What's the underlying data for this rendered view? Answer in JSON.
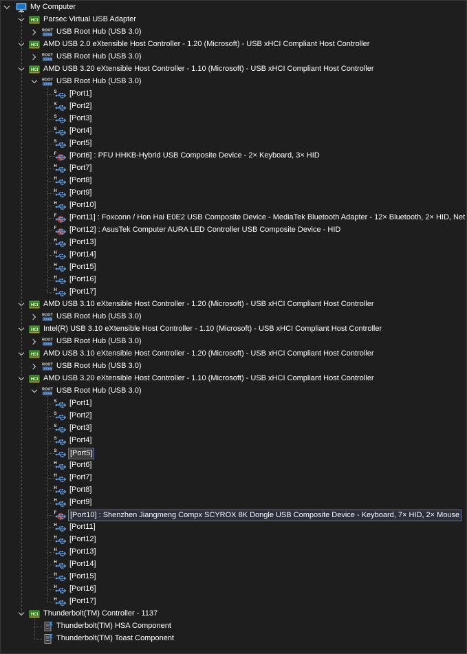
{
  "tree": {
    "root": {
      "label": "My Computer",
      "icon": "computer-icon"
    },
    "controllers": [
      {
        "label": "Parsec Virtual USB Adapter",
        "hub": {
          "label": "USB Root Hub (USB 3.0)",
          "expanded": false,
          "ports": []
        }
      },
      {
        "label": "AMD USB 2.0 eXtensible Host Controller - 1.20 (Microsoft) - USB xHCI Compliant Host Controller",
        "hub": {
          "label": "USB Root Hub (USB 3.0)",
          "expanded": false,
          "ports": []
        }
      },
      {
        "label": "AMD USB 3.20 eXtensible Host Controller - 1.10 (Microsoft) - USB xHCI Compliant Host Controller",
        "hub": {
          "label": "USB Root Hub (USB 3.0)",
          "expanded": true,
          "ports": [
            {
              "label": "[Port1]",
              "type": "S"
            },
            {
              "label": "[Port2]",
              "type": "S"
            },
            {
              "label": "[Port3]",
              "type": "S"
            },
            {
              "label": "[Port4]",
              "type": "S"
            },
            {
              "label": "[Port5]",
              "type": "S"
            },
            {
              "label": "[Port6] : PFU HHKB-Hybrid USB Composite Device - 2× Keyboard, 3× HID",
              "type": "F"
            },
            {
              "label": "[Port7]",
              "type": "H"
            },
            {
              "label": "[Port8]",
              "type": "H"
            },
            {
              "label": "[Port9]",
              "type": "H"
            },
            {
              "label": "[Port10]",
              "type": "H"
            },
            {
              "label": "[Port11] : Foxconn / Hon Hai E0E2 USB Composite Device - MediaTek Bluetooth Adapter - 12× Bluetooth, 2× HID, Net",
              "type": "F"
            },
            {
              "label": "[Port12] : AsusTek Computer AURA LED Controller USB Composite Device - HID",
              "type": "F"
            },
            {
              "label": "[Port13]",
              "type": "H"
            },
            {
              "label": "[Port14]",
              "type": "H"
            },
            {
              "label": "[Port15]",
              "type": "H"
            },
            {
              "label": "[Port16]",
              "type": "H"
            },
            {
              "label": "[Port17]",
              "type": "H"
            }
          ]
        }
      },
      {
        "label": "AMD USB 3.10 eXtensible Host Controller - 1.20 (Microsoft) - USB xHCI Compliant Host Controller",
        "hub": {
          "label": "USB Root Hub (USB 3.0)",
          "expanded": false,
          "ports": []
        }
      },
      {
        "label": "Intel(R) USB 3.10 eXtensible Host Controller - 1.10 (Microsoft) - USB xHCI Compliant Host Controller",
        "hub": {
          "label": "USB Root Hub (USB 3.0)",
          "expanded": false,
          "ports": []
        }
      },
      {
        "label": "AMD USB 3.10 eXtensible Host Controller - 1.20 (Microsoft) - USB xHCI Compliant Host Controller",
        "hub": {
          "label": "USB Root Hub (USB 3.0)",
          "expanded": false,
          "ports": []
        }
      },
      {
        "label": "AMD USB 3.20 eXtensible Host Controller - 1.10 (Microsoft) - USB xHCI Compliant Host Controller",
        "hub": {
          "label": "USB Root Hub (USB 3.0)",
          "expanded": true,
          "ports": [
            {
              "label": "[Port1]",
              "type": "S"
            },
            {
              "label": "[Port2]",
              "type": "S"
            },
            {
              "label": "[Port3]",
              "type": "S"
            },
            {
              "label": "[Port4]",
              "type": "S"
            },
            {
              "label": "[Port5]",
              "type": "S",
              "state": "highlighted"
            },
            {
              "label": "[Port6]",
              "type": "H"
            },
            {
              "label": "[Port7]",
              "type": "H"
            },
            {
              "label": "[Port8]",
              "type": "H"
            },
            {
              "label": "[Port9]",
              "type": "H"
            },
            {
              "label": "[Port10] : Shenzhen Jiangmeng Compx SCYROX 8K Dongle USB Composite Device - Keyboard, 7× HID, 2× Mouse",
              "type": "F",
              "state": "selected"
            },
            {
              "label": "[Port11]",
              "type": "H"
            },
            {
              "label": "[Port12]",
              "type": "H"
            },
            {
              "label": "[Port13]",
              "type": "H"
            },
            {
              "label": "[Port14]",
              "type": "H"
            },
            {
              "label": "[Port15]",
              "type": "H"
            },
            {
              "label": "[Port16]",
              "type": "H"
            },
            {
              "label": "[Port17]",
              "type": "H"
            }
          ]
        }
      }
    ],
    "thunderbolt": {
      "label": "Thunderbolt(TM) Controller - 1137",
      "children": [
        {
          "label": "Thunderbolt(TM) HSA Component"
        },
        {
          "label": "Thunderbolt(TM) Toast Component"
        }
      ]
    },
    "icon_text": {
      "root_hub": "ROOT",
      "hci": "HCI",
      "super": "S",
      "high": "H",
      "full": "F"
    },
    "colors": {
      "background": "#1e1e1e",
      "text": "#ffffff",
      "selection_border": "#6f7aa8",
      "usb_blue": "#4a8fd8",
      "hci_green": "#5bbf3a",
      "device_red": "#d84a4a"
    }
  }
}
